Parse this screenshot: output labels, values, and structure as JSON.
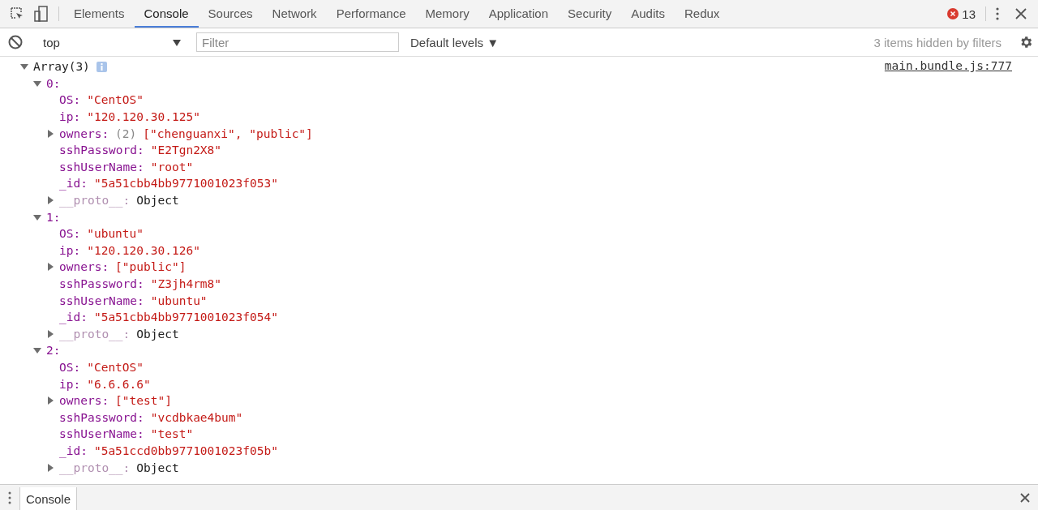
{
  "tabs": [
    {
      "label": "Elements",
      "selected": false
    },
    {
      "label": "Console",
      "selected": true
    },
    {
      "label": "Sources",
      "selected": false
    },
    {
      "label": "Network",
      "selected": false
    },
    {
      "label": "Performance",
      "selected": false
    },
    {
      "label": "Memory",
      "selected": false
    },
    {
      "label": "Application",
      "selected": false
    },
    {
      "label": "Security",
      "selected": false
    },
    {
      "label": "Audits",
      "selected": false
    },
    {
      "label": "Redux",
      "selected": false
    }
  ],
  "error_count": "13",
  "toolbar": {
    "context": "top",
    "filter": {
      "placeholder": "Filter"
    },
    "levels": "Default levels ▼",
    "hidden_note": "3 items hidden by filters"
  },
  "console": {
    "source": "main.bundle.js:777",
    "label": "Array(3)",
    "expanded": true,
    "children": [
      {
        "label": "0:",
        "expanded": true,
        "props": [
          {
            "key": "OS:",
            "kind": "string",
            "value": "\"CentOS\""
          },
          {
            "key": "ip:",
            "kind": "string",
            "value": "\"120.120.30.125\""
          },
          {
            "key": "owners:",
            "kind": "array",
            "count": "(2)",
            "value": "[\"chenguanxi\", \"public\"]",
            "expanded": false
          },
          {
            "key": "sshPassword:",
            "kind": "string",
            "value": "\"E2Tgn2X8\""
          },
          {
            "key": "sshUserName:",
            "kind": "string",
            "value": "\"root\""
          },
          {
            "key": "_id:",
            "kind": "string",
            "value": "\"5a51cbb4bb9771001023f053\""
          },
          {
            "key": "__proto__:",
            "kind": "proto",
            "value": "Object",
            "expanded": false
          }
        ]
      },
      {
        "label": "1:",
        "expanded": true,
        "props": [
          {
            "key": "OS:",
            "kind": "string",
            "value": "\"ubuntu\""
          },
          {
            "key": "ip:",
            "kind": "string",
            "value": "\"120.120.30.126\""
          },
          {
            "key": "owners:",
            "kind": "array",
            "value": "[\"public\"]",
            "expanded": false
          },
          {
            "key": "sshPassword:",
            "kind": "string",
            "value": "\"Z3jh4rm8\""
          },
          {
            "key": "sshUserName:",
            "kind": "string",
            "value": "\"ubuntu\""
          },
          {
            "key": "_id:",
            "kind": "string",
            "value": "\"5a51cbb4bb9771001023f054\""
          },
          {
            "key": "__proto__:",
            "kind": "proto",
            "value": "Object",
            "expanded": false
          }
        ]
      },
      {
        "label": "2:",
        "expanded": true,
        "props": [
          {
            "key": "OS:",
            "kind": "string",
            "value": "\"CentOS\""
          },
          {
            "key": "ip:",
            "kind": "string",
            "value": "\"6.6.6.6\""
          },
          {
            "key": "owners:",
            "kind": "array",
            "value": "[\"test\"]",
            "expanded": false
          },
          {
            "key": "sshPassword:",
            "kind": "string",
            "value": "\"vcdbkae4bum\""
          },
          {
            "key": "sshUserName:",
            "kind": "string",
            "value": "\"test\""
          },
          {
            "key": "_id:",
            "kind": "string",
            "value": "\"5a51ccd0bb9771001023f05b\""
          },
          {
            "key": "__proto__:",
            "kind": "proto",
            "value": "Object",
            "expanded": false
          }
        ]
      }
    ]
  },
  "drawer": {
    "tab": "Console"
  }
}
